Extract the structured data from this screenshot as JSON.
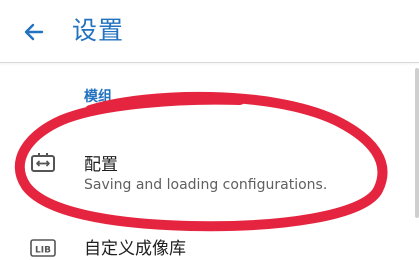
{
  "header": {
    "title": "设置",
    "back_icon": "arrow-left-icon"
  },
  "section": {
    "title": "模组"
  },
  "items": [
    {
      "title": "配置",
      "summary": "Saving and loading configurations.",
      "icon": "config-swap-icon"
    },
    {
      "title": "自定义成像库",
      "icon": "lib-icon",
      "icon_text": "LIB"
    }
  ],
  "colors": {
    "accent": "#2372bf",
    "annotation": "#e5253f"
  }
}
